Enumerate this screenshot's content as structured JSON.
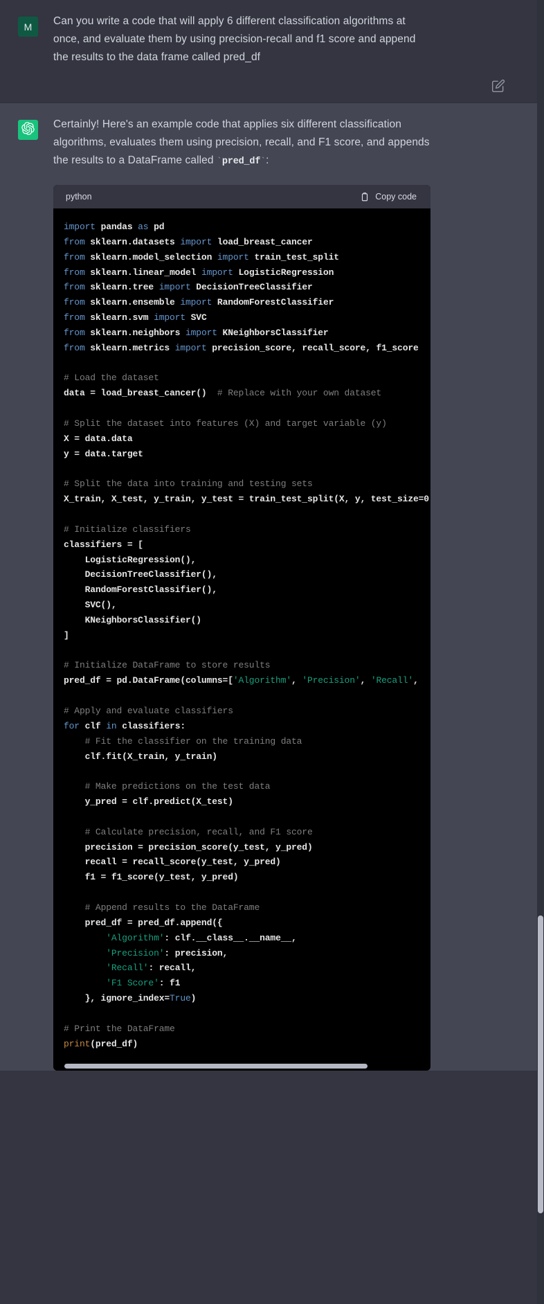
{
  "conversation": {
    "user": {
      "avatar_initial": "M",
      "avatar_color": "#0f5943",
      "message": "Can you write a code that will apply 6 different classification algorithms at once, and evaluate them by using precision-recall and f1 score and append the results to the data frame called pred_df",
      "edit_icon": "pencil-edit-icon"
    },
    "assistant": {
      "avatar_color": "#19c37d",
      "avatar_icon": "openai-logo-icon",
      "intro_part1": "Certainly! Here's an example code that applies six different classification algorithms, evaluates them using precision, recall, and F1 score, and appends the results to a DataFrame called ",
      "intro_code": "pred_df",
      "intro_part2": ":",
      "code_block": {
        "language": "python",
        "copy_label": "Copy code",
        "copy_icon": "clipboard-icon",
        "lines": [
          {
            "t": "import_pandas",
            "segs": [
              [
                "kw",
                "import"
              ],
              [
                "pl",
                " pandas "
              ],
              [
                "kw",
                "as"
              ],
              [
                "pl",
                " pd"
              ]
            ]
          },
          {
            "t": "from_datasets",
            "segs": [
              [
                "kw",
                "from"
              ],
              [
                "pl",
                " sklearn.datasets "
              ],
              [
                "kw",
                "import"
              ],
              [
                "pl",
                " load_breast_cancer"
              ]
            ]
          },
          {
            "t": "from_model_selection",
            "segs": [
              [
                "kw",
                "from"
              ],
              [
                "pl",
                " sklearn.model_selection "
              ],
              [
                "kw",
                "import"
              ],
              [
                "pl",
                " train_test_split"
              ]
            ]
          },
          {
            "t": "from_linear_model",
            "segs": [
              [
                "kw",
                "from"
              ],
              [
                "pl",
                " sklearn.linear_model "
              ],
              [
                "kw",
                "import"
              ],
              [
                "pl",
                " LogisticRegression"
              ]
            ]
          },
          {
            "t": "from_tree",
            "segs": [
              [
                "kw",
                "from"
              ],
              [
                "pl",
                " sklearn.tree "
              ],
              [
                "kw",
                "import"
              ],
              [
                "pl",
                " DecisionTreeClassifier"
              ]
            ]
          },
          {
            "t": "from_ensemble",
            "segs": [
              [
                "kw",
                "from"
              ],
              [
                "pl",
                " sklearn.ensemble "
              ],
              [
                "kw",
                "import"
              ],
              [
                "pl",
                " RandomForestClassifier"
              ]
            ]
          },
          {
            "t": "from_svm",
            "segs": [
              [
                "kw",
                "from"
              ],
              [
                "pl",
                " sklearn.svm "
              ],
              [
                "kw",
                "import"
              ],
              [
                "pl",
                " SVC"
              ]
            ]
          },
          {
            "t": "from_neighbors",
            "segs": [
              [
                "kw",
                "from"
              ],
              [
                "pl",
                " sklearn.neighbors "
              ],
              [
                "kw",
                "import"
              ],
              [
                "pl",
                " KNeighborsClassifier"
              ]
            ]
          },
          {
            "t": "from_metrics",
            "segs": [
              [
                "kw",
                "from"
              ],
              [
                "pl",
                " sklearn.metrics "
              ],
              [
                "kw",
                "import"
              ],
              [
                "pl",
                " precision_score, recall_score, f1_score"
              ]
            ]
          },
          {
            "t": "blank",
            "segs": [
              [
                "pl",
                ""
              ]
            ]
          },
          {
            "t": "comment_load",
            "segs": [
              [
                "cm",
                "# Load the dataset"
              ]
            ]
          },
          {
            "t": "data_assign",
            "segs": [
              [
                "pl",
                "data = load_breast_cancer()  "
              ],
              [
                "cm",
                "# Replace with your own dataset"
              ]
            ]
          },
          {
            "t": "blank",
            "segs": [
              [
                "pl",
                ""
              ]
            ]
          },
          {
            "t": "comment_split_features",
            "segs": [
              [
                "cm",
                "# Split the dataset into features (X) and target variable (y)"
              ]
            ]
          },
          {
            "t": "x_assign",
            "segs": [
              [
                "pl",
                "X = data.data"
              ]
            ]
          },
          {
            "t": "y_assign",
            "segs": [
              [
                "pl",
                "y = data.target"
              ]
            ]
          },
          {
            "t": "blank",
            "segs": [
              [
                "pl",
                ""
              ]
            ]
          },
          {
            "t": "comment_split_train",
            "segs": [
              [
                "cm",
                "# Split the data into training and testing sets"
              ]
            ]
          },
          {
            "t": "train_test_split",
            "segs": [
              [
                "pl",
                "X_train, X_test, y_train, y_test = train_test_split(X, y, test_size=0"
              ]
            ]
          },
          {
            "t": "blank",
            "segs": [
              [
                "pl",
                ""
              ]
            ]
          },
          {
            "t": "comment_init_clf",
            "segs": [
              [
                "cm",
                "# Initialize classifiers"
              ]
            ]
          },
          {
            "t": "classifiers_open",
            "segs": [
              [
                "pl",
                "classifiers = ["
              ]
            ]
          },
          {
            "t": "clf_logreg",
            "segs": [
              [
                "pl",
                "    LogisticRegression(),"
              ]
            ]
          },
          {
            "t": "clf_dtree",
            "segs": [
              [
                "pl",
                "    DecisionTreeClassifier(),"
              ]
            ]
          },
          {
            "t": "clf_rf",
            "segs": [
              [
                "pl",
                "    RandomForestClassifier(),"
              ]
            ]
          },
          {
            "t": "clf_svc",
            "segs": [
              [
                "pl",
                "    SVC(),"
              ]
            ]
          },
          {
            "t": "clf_knn",
            "segs": [
              [
                "pl",
                "    KNeighborsClassifier()"
              ]
            ]
          },
          {
            "t": "classifiers_close",
            "segs": [
              [
                "pl",
                "]"
              ]
            ]
          },
          {
            "t": "blank",
            "segs": [
              [
                "pl",
                ""
              ]
            ]
          },
          {
            "t": "comment_init_df",
            "segs": [
              [
                "cm",
                "# Initialize DataFrame to store results"
              ]
            ]
          },
          {
            "t": "pred_df_init",
            "segs": [
              [
                "pl",
                "pred_df = pd.DataFrame(columns=["
              ],
              [
                "st",
                "'Algorithm'"
              ],
              [
                "pl",
                ", "
              ],
              [
                "st",
                "'Precision'"
              ],
              [
                "pl",
                ", "
              ],
              [
                "st",
                "'Recall'"
              ],
              [
                "pl",
                ","
              ]
            ]
          },
          {
            "t": "blank",
            "segs": [
              [
                "pl",
                ""
              ]
            ]
          },
          {
            "t": "comment_apply",
            "segs": [
              [
                "cm",
                "# Apply and evaluate classifiers"
              ]
            ]
          },
          {
            "t": "for_loop",
            "segs": [
              [
                "kw",
                "for"
              ],
              [
                "pl",
                " clf "
              ],
              [
                "kw",
                "in"
              ],
              [
                "pl",
                " classifiers:"
              ]
            ]
          },
          {
            "t": "comment_fit",
            "segs": [
              [
                "pl",
                "    "
              ],
              [
                "cm",
                "# Fit the classifier on the training data"
              ]
            ]
          },
          {
            "t": "clf_fit",
            "segs": [
              [
                "pl",
                "    clf.fit(X_train, y_train)"
              ]
            ]
          },
          {
            "t": "blank",
            "segs": [
              [
                "pl",
                ""
              ]
            ]
          },
          {
            "t": "comment_predict",
            "segs": [
              [
                "pl",
                "    "
              ],
              [
                "cm",
                "# Make predictions on the test data"
              ]
            ]
          },
          {
            "t": "y_pred",
            "segs": [
              [
                "pl",
                "    y_pred = clf.predict(X_test)"
              ]
            ]
          },
          {
            "t": "blank",
            "segs": [
              [
                "pl",
                ""
              ]
            ]
          },
          {
            "t": "comment_calc",
            "segs": [
              [
                "pl",
                "    "
              ],
              [
                "cm",
                "# Calculate precision, recall, and F1 score"
              ]
            ]
          },
          {
            "t": "precision_calc",
            "segs": [
              [
                "pl",
                "    precision = precision_score(y_test, y_pred)"
              ]
            ]
          },
          {
            "t": "recall_calc",
            "segs": [
              [
                "pl",
                "    recall = recall_score(y_test, y_pred)"
              ]
            ]
          },
          {
            "t": "f1_calc",
            "segs": [
              [
                "pl",
                "    f1 = f1_score(y_test, y_pred)"
              ]
            ]
          },
          {
            "t": "blank",
            "segs": [
              [
                "pl",
                ""
              ]
            ]
          },
          {
            "t": "comment_append",
            "segs": [
              [
                "pl",
                "    "
              ],
              [
                "cm",
                "# Append results to the DataFrame"
              ]
            ]
          },
          {
            "t": "append_open",
            "segs": [
              [
                "pl",
                "    pred_df = pred_df.append({"
              ]
            ]
          },
          {
            "t": "append_algorithm",
            "segs": [
              [
                "pl",
                "        "
              ],
              [
                "st",
                "'Algorithm'"
              ],
              [
                "pl",
                ": clf.__class__.__name__,"
              ]
            ]
          },
          {
            "t": "append_precision",
            "segs": [
              [
                "pl",
                "        "
              ],
              [
                "st",
                "'Precision'"
              ],
              [
                "pl",
                ": precision,"
              ]
            ]
          },
          {
            "t": "append_recall",
            "segs": [
              [
                "pl",
                "        "
              ],
              [
                "st",
                "'Recall'"
              ],
              [
                "pl",
                ": recall,"
              ]
            ]
          },
          {
            "t": "append_f1",
            "segs": [
              [
                "pl",
                "        "
              ],
              [
                "st",
                "'F1 Score'"
              ],
              [
                "pl",
                ": f1"
              ]
            ]
          },
          {
            "t": "append_close",
            "segs": [
              [
                "pl",
                "    }, ignore_index="
              ],
              [
                "cn",
                "True"
              ],
              [
                "pl",
                ")"
              ]
            ]
          },
          {
            "t": "blank",
            "segs": [
              [
                "pl",
                ""
              ]
            ]
          },
          {
            "t": "comment_print",
            "segs": [
              [
                "cm",
                "# Print the DataFrame"
              ]
            ]
          },
          {
            "t": "print_df",
            "segs": [
              [
                "bi",
                "print"
              ],
              [
                "pl",
                "(pred_df)"
              ]
            ]
          }
        ]
      }
    }
  }
}
